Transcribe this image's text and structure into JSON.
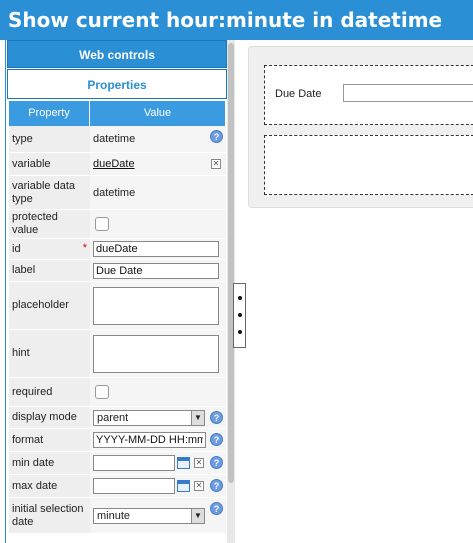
{
  "app": {
    "title": "Show current hour:minute in datetime"
  },
  "left": {
    "web_controls_label": "Web controls",
    "properties_tab_label": "Properties",
    "table": {
      "header_property": "Property",
      "header_value": "Value",
      "rows": {
        "type": {
          "label": "type",
          "value": "datetime"
        },
        "variable": {
          "label": "variable",
          "value": "dueDate"
        },
        "variable_data_type": {
          "label": "variable data type",
          "value": "datetime"
        },
        "protected_value": {
          "label": "protected value"
        },
        "id": {
          "label": "id",
          "value": "dueDate",
          "required_mark": "*"
        },
        "label": {
          "label": "label",
          "value": "Due Date"
        },
        "placeholder": {
          "label": "placeholder",
          "value": ""
        },
        "hint": {
          "label": "hint",
          "value": ""
        },
        "required": {
          "label": "required"
        },
        "display_mode": {
          "label": "display mode",
          "value": "parent"
        },
        "format": {
          "label": "format",
          "value": "YYYY-MM-DD HH:mm"
        },
        "min_date": {
          "label": "min date",
          "value": ""
        },
        "max_date": {
          "label": "max date",
          "value": ""
        },
        "initial_selection_date": {
          "label": "initial selection date",
          "value": "minute"
        }
      }
    }
  },
  "canvas": {
    "field_label": "Due Date"
  },
  "colors": {
    "accent": "#2a8fd4",
    "header": "#3a9be0",
    "required": "#dd0000"
  },
  "icons": [
    "help-icon",
    "clear-icon",
    "calendar-icon",
    "dropdown-arrow-icon"
  ]
}
